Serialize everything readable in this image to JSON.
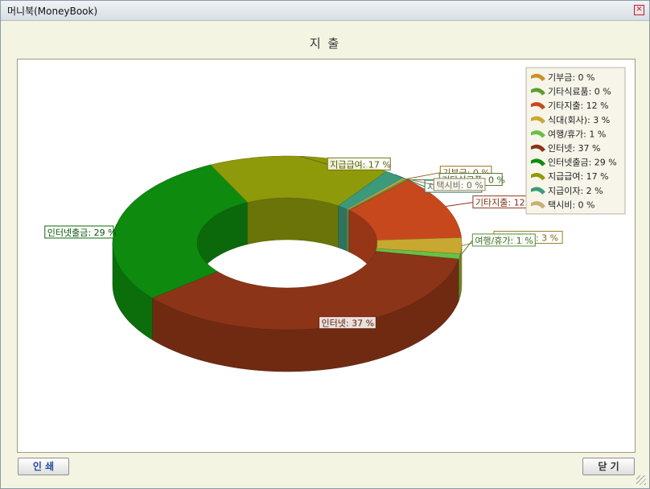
{
  "window": {
    "title": "머니북(MoneyBook)",
    "close_symbol": "✕"
  },
  "heading": "지 출",
  "buttons": {
    "print": "인 쇄",
    "close": "닫 기"
  },
  "chart_data": {
    "type": "pie",
    "style": "3d-donut",
    "title": "지 출",
    "legend_position": "top-right",
    "series": [
      {
        "name": "기부금",
        "value": 0,
        "color": "#c9922a"
      },
      {
        "name": "기타식료품",
        "value": 0,
        "color": "#5e9e2f"
      },
      {
        "name": "기타지출",
        "value": 12,
        "color": "#c8481e"
      },
      {
        "name": "식대(회사)",
        "value": 3,
        "color": "#c8a830"
      },
      {
        "name": "여행/휴가",
        "value": 1,
        "color": "#6abf45"
      },
      {
        "name": "인터넷",
        "value": 37,
        "color": "#8c3417"
      },
      {
        "name": "인터넷출금",
        "value": 29,
        "color": "#0e8a0e"
      },
      {
        "name": "지급급여",
        "value": 17,
        "color": "#8f9a0a"
      },
      {
        "name": "지급이자",
        "value": 2,
        "color": "#3a9a7a"
      },
      {
        "name": "택시비",
        "value": 0,
        "color": "#c8b070"
      }
    ]
  }
}
